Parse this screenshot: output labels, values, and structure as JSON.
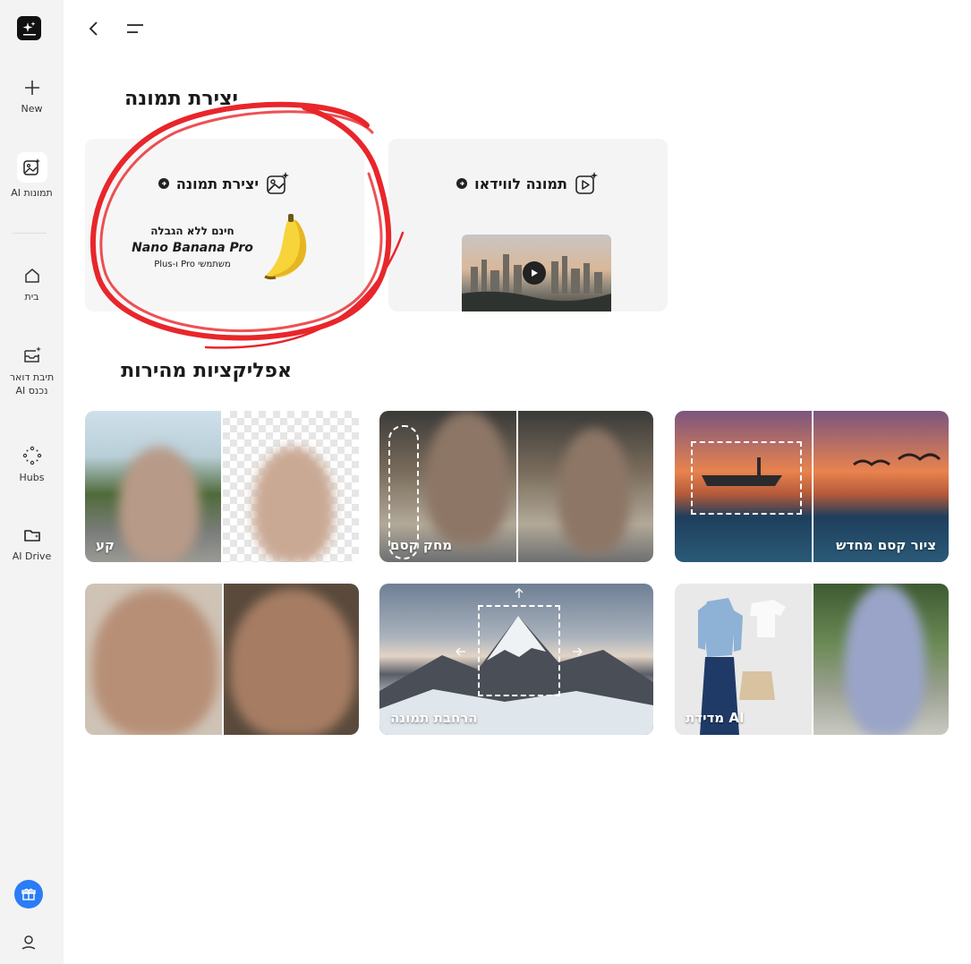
{
  "sidebar": {
    "items": [
      {
        "label": "New",
        "icon": "plus-icon"
      },
      {
        "label": "AI תמונות",
        "icon": "image-sparkle-icon"
      },
      {
        "label": "בית",
        "icon": "home-icon"
      },
      {
        "label": "תיבת דואר\nAI נכנס",
        "icon": "inbox-sparkle-icon"
      },
      {
        "label": "Hubs",
        "icon": "hubs-icon"
      },
      {
        "label": "AI Drive",
        "icon": "folder-icon"
      }
    ]
  },
  "sections": {
    "create_title": "יצירת תמונה",
    "apps_title": "אפליקציות מהירות"
  },
  "cards": {
    "create": {
      "title": "יצירת תמונה",
      "promo_line1": "חינם ללא הגבלה",
      "promo_line2": "Nano Banana Pro",
      "promo_line3": "משתמשי Pro ו-Plus"
    },
    "video": {
      "title": "תמונה לווידאו"
    }
  },
  "tiles": [
    {
      "label": "קע"
    },
    {
      "label": "מחק קסם"
    },
    {
      "label": "ציור קסם מחדש"
    },
    {
      "label": ""
    },
    {
      "label": "הרחבת תמונה"
    },
    {
      "label": "AI מדידת"
    }
  ],
  "colors": {
    "accent_blue": "#2b7cf6",
    "sidebar_bg": "#f3f3f3",
    "annotation_red": "#e8262b"
  }
}
